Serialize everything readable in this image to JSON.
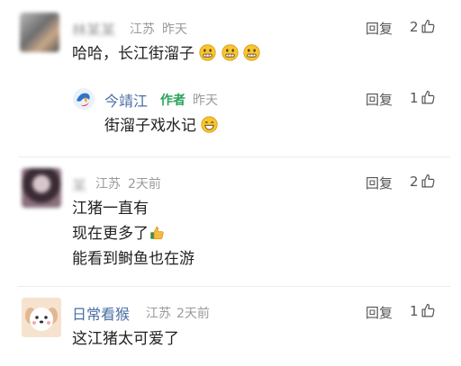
{
  "comments": [
    {
      "username": "林某某",
      "location": "江苏",
      "time": "昨天",
      "text": "哈哈，长江街溜子",
      "reply_label": "回复",
      "likes": "2"
    },
    {
      "username": "今靖江",
      "badge": "作者",
      "time": "昨天",
      "text": "街溜子戏水记",
      "reply_label": "回复",
      "likes": "1"
    },
    {
      "username": "某",
      "location": "江苏",
      "time": "2天前",
      "lines": [
        "江猪一直有",
        "现在更多了",
        "能看到鲥鱼也在游"
      ],
      "reply_label": "回复",
      "likes": "2"
    },
    {
      "username": "日常看猴",
      "location": "江苏",
      "time": "2天前",
      "text": "这江猪太可爱了",
      "reply_label": "回复",
      "likes": "1"
    }
  ],
  "icons": {
    "like": "thumbs-up-outline-icon",
    "emoji_grimace": "grimace-emoji-icon",
    "emoji_grin": "grinning-emoji-icon",
    "emoji_thumb": "thumbs-up-emoji-icon"
  },
  "colors": {
    "author_badge": "#2aa35a",
    "name_link": "#4a6fa5",
    "meta": "#9a9a9a"
  }
}
